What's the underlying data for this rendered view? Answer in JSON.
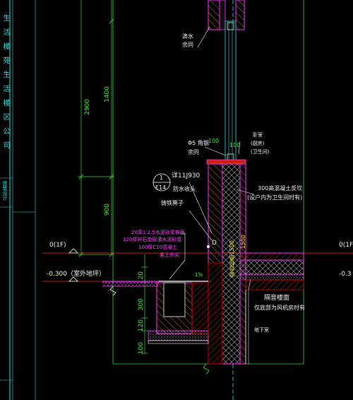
{
  "colors": {
    "background": "#000000",
    "wall_outline": "#ff33ff",
    "dimension": "#33dd33",
    "grid": "#2fe0e0",
    "concrete": "#cc0000",
    "text": "#ffffff",
    "callout": "#e8e81a"
  },
  "side_panel": {
    "title_chars": [
      "生",
      "活",
      "楼",
      "苑",
      "生",
      "活",
      "楼",
      "区",
      "公",
      "司"
    ],
    "tag_text": "建筑设计"
  },
  "dimensions": {
    "total_height": "2900",
    "upper": "1400",
    "lower": "900",
    "sill": "20",
    "foundation_300": "300",
    "foundation_120": "120",
    "foundation_100": "100",
    "wall_thickness": "100",
    "frame_100": "100",
    "slope_note": "1%",
    "window_sill_height": "1500"
  },
  "levels": {
    "floor": "0(1F)",
    "outdoor": "-0.300（室外地坪）",
    "right_floor": "0(1F",
    "right_outdoor": "-0.3"
  },
  "annotations": {
    "drip": "滴水",
    "drip_sub": "余同",
    "steel": "Φ5 角钢",
    "steel_sub": "余同",
    "room_top": "卧室",
    "room_sub1": "(厨房)",
    "room_sub2": "(卫生间)",
    "detail_ref": "详11J930",
    "callout_num": "1",
    "callout_ref": "E14",
    "waterproof": "防水收头",
    "downpipe": "铸铁箅子",
    "upturn": "300高混凝土反坎",
    "upturn_sub": "(设户内为卫生间时有)",
    "point_d": "D",
    "layer1": "20厚1:2.5水泥砂浆抹面",
    "layer2": "120厚碎石垫层灌水泥砂浆",
    "layer3": "100厚C10混凝土",
    "layer4": "素土夯实",
    "wall_vertical": "窗台标高1500",
    "insulation": "隔音楼面",
    "insulation_sub": "仅底部为风机房时有",
    "basement": "地下室"
  }
}
